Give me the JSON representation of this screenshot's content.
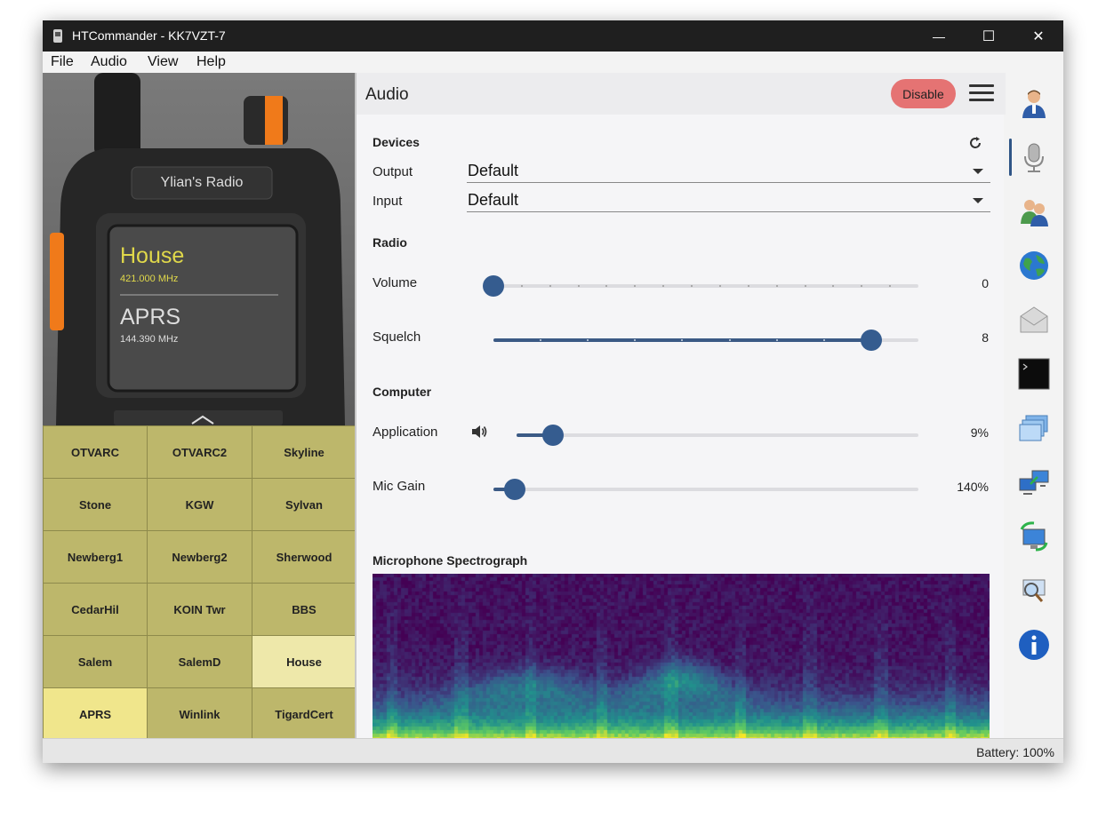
{
  "window": {
    "title": "HTCommander - KK7VZT-7",
    "minimize": "—",
    "maximize": "☐",
    "close": "✕"
  },
  "menu": [
    "File",
    "Audio",
    "View",
    "Help"
  ],
  "radio": {
    "brand_label": "Ylian's Radio",
    "vfo_a": {
      "name": "House",
      "freq": "421.000 MHz"
    },
    "vfo_b": {
      "name": "APRS",
      "freq": "144.390 MHz"
    }
  },
  "channels": [
    {
      "name": "OTVARC",
      "state": "normal"
    },
    {
      "name": "OTVARC2",
      "state": "normal"
    },
    {
      "name": "Skyline",
      "state": "normal"
    },
    {
      "name": "Stone",
      "state": "normal"
    },
    {
      "name": "KGW",
      "state": "normal"
    },
    {
      "name": "Sylvan",
      "state": "normal"
    },
    {
      "name": "Newberg1",
      "state": "normal"
    },
    {
      "name": "Newberg2",
      "state": "normal"
    },
    {
      "name": "Sherwood",
      "state": "normal"
    },
    {
      "name": "CedarHil",
      "state": "normal"
    },
    {
      "name": "KOIN Twr",
      "state": "normal"
    },
    {
      "name": "BBS",
      "state": "normal"
    },
    {
      "name": "Salem",
      "state": "normal"
    },
    {
      "name": "SalemD",
      "state": "normal"
    },
    {
      "name": "House",
      "state": "selected"
    },
    {
      "name": "APRS",
      "state": "active"
    },
    {
      "name": "Winlink",
      "state": "normal"
    },
    {
      "name": "TigardCert",
      "state": "normal"
    }
  ],
  "audio": {
    "title": "Audio",
    "disable_label": "Disable",
    "devices": {
      "title": "Devices",
      "output_label": "Output",
      "output_value": "Default",
      "input_label": "Input",
      "input_value": "Default"
    },
    "radio_section": {
      "title": "Radio",
      "volume_label": "Volume",
      "volume_value": "0",
      "volume_level": 0,
      "volume_max": 15,
      "squelch_label": "Squelch",
      "squelch_value": "8",
      "squelch_level": 8,
      "squelch_max": 9
    },
    "computer": {
      "title": "Computer",
      "app_label": "Application",
      "app_value": "9%",
      "app_level": 0.09,
      "mic_label": "Mic Gain",
      "mic_value": "140%",
      "mic_level": 0.05
    },
    "spectrograph_title": "Microphone Spectrograph"
  },
  "sidebar_icons": [
    "user-icon",
    "microphone-icon",
    "users-icon",
    "globe-icon",
    "mail-icon",
    "terminal-icon",
    "windows-icon",
    "network-icon",
    "sync-icon",
    "search-icon",
    "info-icon"
  ],
  "status": {
    "battery": "Battery: 100%"
  },
  "colors": {
    "accent": "#355c8f",
    "channel": "#bdb76b",
    "channel_selected": "#eee8aa",
    "disable": "#e57373"
  }
}
